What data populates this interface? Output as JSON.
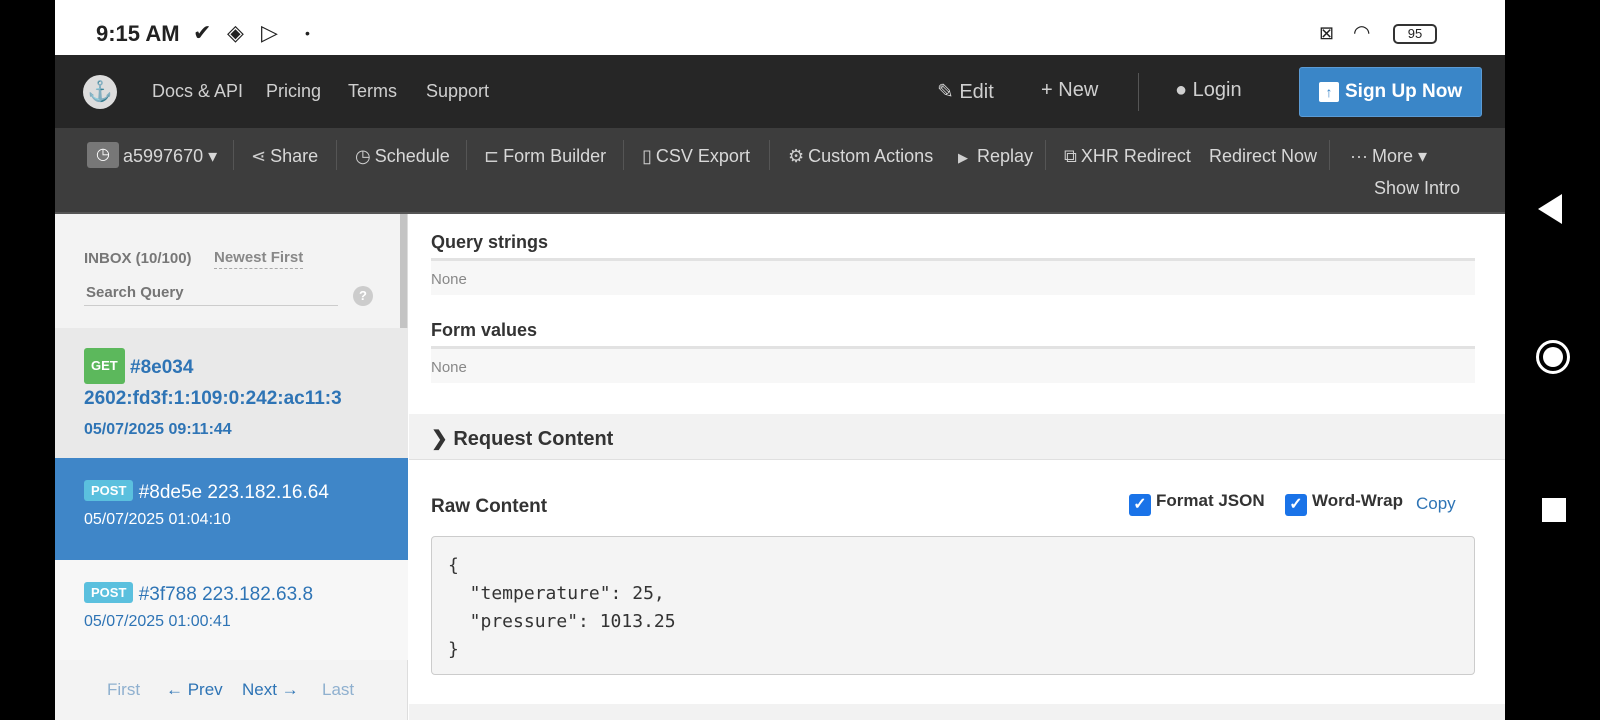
{
  "status_bar": {
    "time": "9:15 AM",
    "battery": "95"
  },
  "topnav": {
    "links": [
      "Docs & API",
      "Pricing",
      "Terms",
      "Support"
    ],
    "edit_label": "Edit",
    "new_label": "New",
    "login_label": "Login",
    "signup_label": "Sign Up Now"
  },
  "toolbar": {
    "token": "a5997670",
    "share": "Share",
    "schedule": "Schedule",
    "form_builder": "Form Builder",
    "csv_export": "CSV Export",
    "custom_actions": "Custom Actions",
    "replay": "Replay",
    "xhr_redirect": "XHR Redirect",
    "redirect_now": "Redirect Now",
    "more": "More",
    "show_intro": "Show Intro"
  },
  "sidebar": {
    "inbox": "INBOX (10/100)",
    "sort": "Newest First",
    "search_placeholder": "Search Query",
    "help": "?",
    "requests": [
      {
        "method": "GET",
        "id": "#8e034",
        "ip": "2602:fd3f:1:109:0:242:ac11:3",
        "date": "05/07/2025 09:11:44"
      },
      {
        "method": "POST",
        "id": "#8de5e",
        "ip": "223.182.16.64",
        "date": "05/07/2025 01:04:10"
      },
      {
        "method": "POST",
        "id": "#3f788",
        "ip": "223.182.63.8",
        "date": "05/07/2025 01:00:41"
      }
    ],
    "pager": {
      "first": "First",
      "prev": "← Prev",
      "next": "Next →",
      "last": "Last"
    }
  },
  "main": {
    "query_strings_label": "Query strings",
    "query_strings_value": "None",
    "form_values_label": "Form values",
    "form_values_value": "None",
    "request_content_label": "Request Content",
    "raw_content_label": "Raw Content",
    "format_json_label": "Format JSON",
    "word_wrap_label": "Word-Wrap",
    "copy_label": "Copy",
    "raw_content": "{\n  \"temperature\": 25,\n  \"pressure\": 1013.25\n}"
  },
  "colors": {
    "get_badge": "#5cb85c",
    "post_badge": "#5bc0de",
    "accent": "#3a86c8"
  }
}
